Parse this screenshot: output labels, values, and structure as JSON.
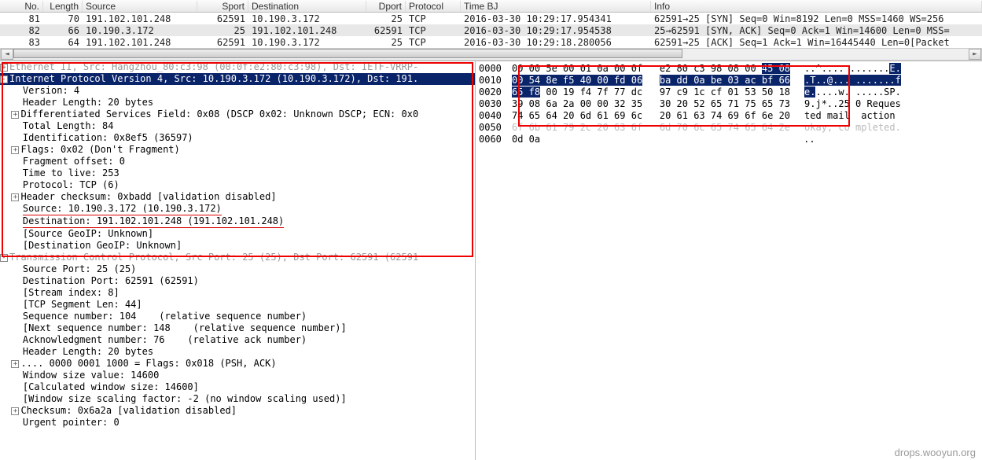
{
  "packet_list": {
    "columns": [
      "No.",
      "Length",
      "Source",
      "Sport",
      "Destination",
      "Dport",
      "Protocol",
      "Time BJ",
      "Info"
    ],
    "rows": [
      {
        "no": "81",
        "len": "70",
        "src": "191.102.101.248",
        "sport": "62591",
        "dst": "10.190.3.172",
        "dport": "25",
        "proto": "TCP",
        "time": "2016-03-30 10:29:17.954341",
        "info": "62591→25 [SYN] Seq=0 Win=8192 Len=0 MSS=1460 WS=256"
      },
      {
        "no": "82",
        "len": "66",
        "src": "10.190.3.172",
        "sport": "25",
        "dst": "191.102.101.248",
        "dport": "62591",
        "proto": "TCP",
        "time": "2016-03-30 10:29:17.954538",
        "info": "25→62591 [SYN, ACK] Seq=0 Ack=1 Win=14600 Len=0 MSS="
      },
      {
        "no": "83",
        "len": "64",
        "src": "191.102.101.248",
        "sport": "62591",
        "dst": "10.190.3.172",
        "dport": "25",
        "proto": "TCP",
        "time": "2016-03-30 10:29:18.280056",
        "info": "62591→25 [ACK] Seq=1 Ack=1 Win=16445440 Len=0[Packet"
      }
    ]
  },
  "details": {
    "eth": "Ethernet II, Src: Hangzhou_80:c3:98 (00:0f:e2:80:c3:98), Dst: IETF-VRRP-",
    "ip_header": "Internet Protocol Version 4, Src: 10.190.3.172 (10.190.3.172), Dst: 191.",
    "ip": {
      "version": "Version: 4",
      "hlen": "Header Length: 20 bytes",
      "dsf": "Differentiated Services Field: 0x08 (DSCP 0x02: Unknown DSCP; ECN: 0x0",
      "totlen": "Total Length: 84",
      "id": "Identification: 0x8ef5 (36597)",
      "flags": "Flags: 0x02 (Don't Fragment)",
      "fragoff": "Fragment offset: 0",
      "ttl": "Time to live: 253",
      "proto": "Protocol: TCP (6)",
      "cksum": "Header checksum: 0xbadd [validation disabled]",
      "src": "Source: 10.190.3.172 (10.190.3.172)",
      "dst": "Destination: 191.102.101.248 (191.102.101.248)",
      "sgeo": "[Source GeoIP: Unknown]",
      "dgeo": "[Destination GeoIP: Unknown]"
    },
    "tcp_header": "Transmission Control Protocol, Src Port: 25 (25), Dst Port: 62591 (62591",
    "tcp": {
      "sport": "Source Port: 25 (25)",
      "dport": "Destination Port: 62591 (62591)",
      "stream": "[Stream index: 8]",
      "seglen": "[TCP Segment Len: 44]",
      "seq": "Sequence number: 104    (relative sequence number)",
      "nseq": "[Next sequence number: 148    (relative sequence number)]",
      "ack": "Acknowledgment number: 76    (relative ack number)",
      "hlen": "Header Length: 20 bytes",
      "flags": ".... 0000 0001 1000 = Flags: 0x018 (PSH, ACK)",
      "win": "Window size value: 14600",
      "cwin": "[Calculated window size: 14600]",
      "wscale": "[Window size scaling factor: -2 (no window scaling used)]",
      "cksum": "Checksum: 0x6a2a [validation disabled]",
      "urg": "Urgent pointer: 0"
    }
  },
  "hex": {
    "rows": [
      {
        "off": "0000",
        "b1": "00 00 5e 00 01 0a 00 0f",
        "b2": "e2 80 c3 98 08 00 ",
        "hl2": "45 08",
        "a1": "..^.... .",
        "a2": "......",
        "ah": "E."
      },
      {
        "off": "0010",
        "hl1": "00 54 8e f5 40 00 fd 06",
        "hl2": "ba dd 0a be 03 ac bf 66",
        "a": ".T..@... .......f"
      },
      {
        "off": "0020",
        "hl1": "65 f8",
        "b1": " 00 19 f4 7f 77 dc",
        "b2": "97 c9 1c cf 01 53 50 18",
        "ah": "e.",
        "a": "....w. .....SP."
      },
      {
        "off": "0030",
        "b1": "39 08 6a 2a 00 00 32 35",
        "b2": "30 20 52 65 71 75 65 73",
        "a": "9.j*..25 0 Reques"
      },
      {
        "off": "0040",
        "b1": "74 65 64 20 6d 61 69 6c",
        "b2": "20 61 63 74 69 6f 6e 20",
        "a": "ted mail  action "
      },
      {
        "off": "0050",
        "b1": "6f 6b 61 79 2c 20 63 6f",
        "b2": "6d 70 6c 65 74 65 64 2e",
        "a": "okay, co mpleted."
      },
      {
        "off": "0060",
        "b1": "0d 0a",
        "b2": "",
        "a": ".."
      }
    ]
  },
  "watermark": "drops.wooyun.org"
}
